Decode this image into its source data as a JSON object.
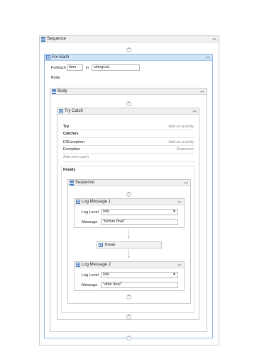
{
  "sequence": {
    "title": "Sequence"
  },
  "foreach": {
    "title": "For Each",
    "foreach_label": "ForEach",
    "item_value": "item",
    "in_label": "in",
    "list_value": "stringList",
    "body_label": "Body"
  },
  "body": {
    "title": "Body"
  },
  "trycatch": {
    "title": "Try Catch",
    "try_label": "Try",
    "try_hint": "Add an activity",
    "catches_label": "Catches",
    "catches": [
      {
        "exception": "IOException",
        "hint": "Add an activity"
      },
      {
        "exception": "Exception",
        "hint": "Sequence"
      }
    ],
    "add_new_catch": "Add new catch",
    "finally_label": "Finally"
  },
  "inner_sequence": {
    "title": "Sequence"
  },
  "log1": {
    "title": "Log Message 1",
    "level_label": "Log Level",
    "level_value": "Info",
    "message_label": "Message",
    "message_value": "\"before final\""
  },
  "break": {
    "title": "Break"
  },
  "log2": {
    "title": "Log Message 2",
    "level_label": "Log Level",
    "level_value": "Info",
    "message_label": "Message",
    "message_value": "\"after final\""
  },
  "icons": {
    "collapse": "double-chevron-up-icon",
    "add": "plus-circle-icon"
  },
  "colors": {
    "selected_header": "#cfe3f7",
    "accent": "#4a7ec0"
  }
}
